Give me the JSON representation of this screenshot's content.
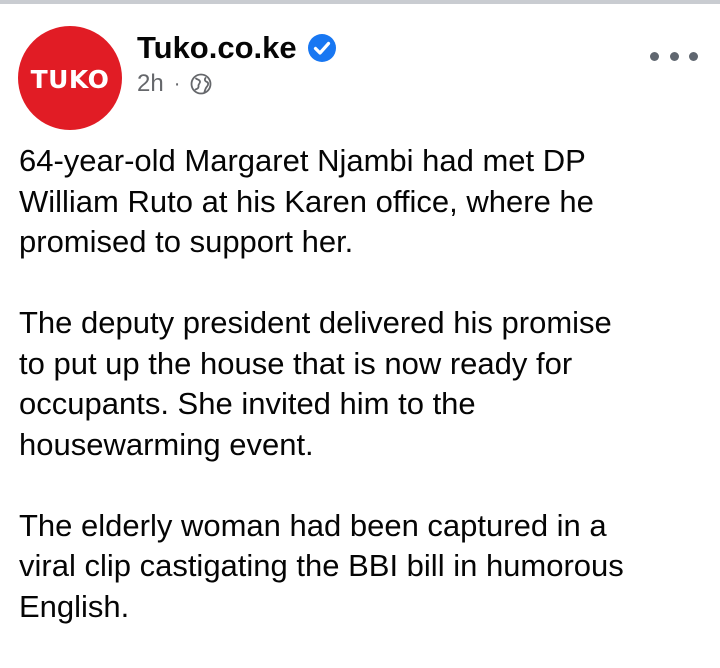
{
  "post": {
    "page_name": "Tuko.co.ke",
    "avatar_text": "TUKO",
    "timestamp": "2h",
    "separator": "·",
    "audience_icon": "globe-icon",
    "verified_icon": "verified-badge-icon",
    "more_icon": "more-options-icon",
    "paragraphs": [
      "64-year-old Margaret Njambi had met DP\nWilliam Ruto at his Karen office, where he\npromised to support her.",
      "The deputy president delivered his promise\nto put up the house that is now ready for\noccupants. She invited him to the\nhousewarming event.",
      "The elderly woman had been captured in a\nviral clip castigating the BBI bill in humorous\nEnglish."
    ]
  },
  "colors": {
    "brand_red": "#e11c25",
    "verified_blue": "#1877f2",
    "meta_gray": "#65676b",
    "text": "#050505"
  }
}
